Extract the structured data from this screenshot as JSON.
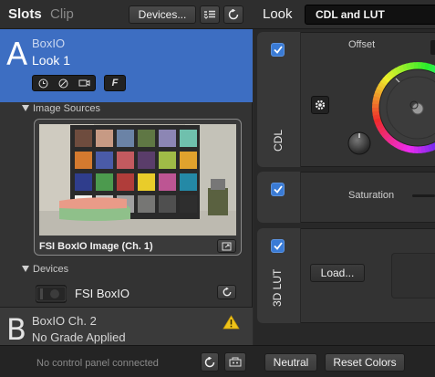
{
  "header": {
    "slots_tab": "Slots",
    "clip_tab": "Clip",
    "devices_button": "Devices...",
    "look_label": "Look",
    "look_value": "CDL and LUT"
  },
  "slot_a": {
    "letter": "A",
    "name": "BoxIO",
    "look": "Look 1",
    "f_button": "F"
  },
  "image_sources": {
    "header": "Image Sources",
    "caption": "FSI BoxIO Image (Ch. 1)"
  },
  "devices": {
    "header": "Devices",
    "device_name": "FSI BoxIO"
  },
  "slot_b": {
    "letter": "B",
    "name": "BoxIO Ch. 2",
    "status": "No Grade Applied"
  },
  "footer": {
    "status": "No control panel connected",
    "neutral_button": "Neutral",
    "reset_button": "Reset Colors"
  },
  "cdl_panel": {
    "label": "CDL",
    "offset_label": "Offset"
  },
  "saturation_panel": {
    "label": "Saturation"
  },
  "lut_panel": {
    "label": "3D LUT",
    "load_button": "Load..."
  },
  "colors": {
    "accent": "#3d6ec2",
    "checkbox": "#3a7bd5",
    "warning": "#f0c419"
  },
  "icons": [
    "gear-icon",
    "refresh-icon",
    "list-icon",
    "clock-icon",
    "bypass-icon",
    "camera-icon",
    "warning-icon",
    "export-icon",
    "panel-icon",
    "checkmark-icon",
    "disclosure-triangle-icon"
  ]
}
